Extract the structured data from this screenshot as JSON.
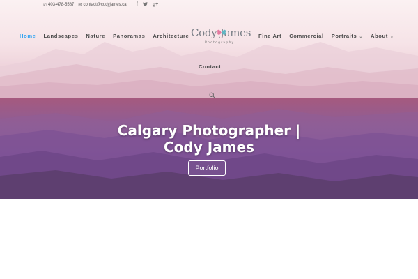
{
  "topbar": {
    "phone": "403-478-5587",
    "email": "contact@codyjames.ca",
    "social": [
      {
        "icon": "facebook-icon",
        "glyph": "f"
      },
      {
        "icon": "twitter-icon",
        "glyph": "🐦"
      },
      {
        "icon": "google-plus-icon",
        "glyph": "g+"
      }
    ]
  },
  "nav": {
    "left": [
      {
        "label": "Home",
        "active": true
      },
      {
        "label": "Landscapes"
      },
      {
        "label": "Nature"
      },
      {
        "label": "Panoramas"
      },
      {
        "label": "Architecture"
      }
    ],
    "right": [
      {
        "label": "Fine Art"
      },
      {
        "label": "Commercial"
      },
      {
        "label": "Portraits",
        "dropdown": true
      },
      {
        "label": "About",
        "dropdown": true
      }
    ],
    "second_row": "Contact",
    "caret_glyph": "⌄"
  },
  "logo": {
    "name": "Cody James",
    "tagline": "Photography"
  },
  "hero": {
    "title": "Calgary Photographer | Cody James",
    "button_label": "Portfolio"
  },
  "colors": {
    "accent": "#2ea3f2",
    "nav_text": "#4a4a4a",
    "hero_top": "#a65a7e",
    "hero_bottom": "#5a3c6e"
  }
}
